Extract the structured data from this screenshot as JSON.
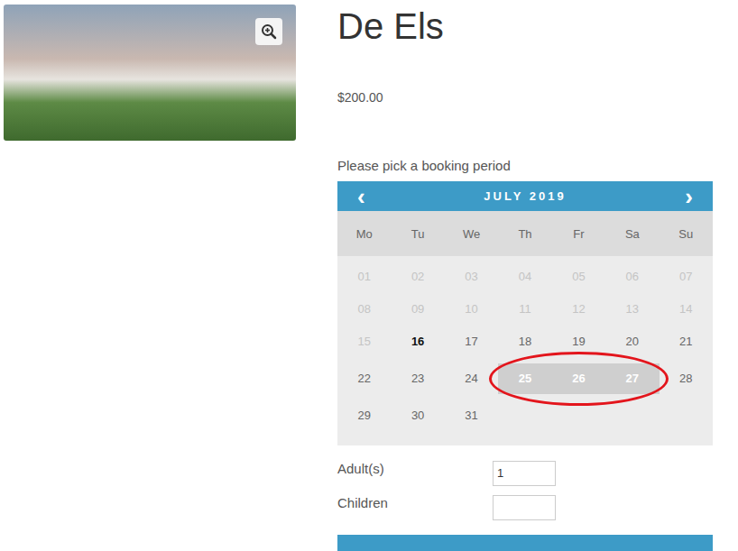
{
  "product": {
    "title": "De Els",
    "price": "$200.00"
  },
  "booking": {
    "prompt": "Please pick a booking period",
    "calendar": {
      "month": "JULY 2019",
      "prev": "‹",
      "next": "›",
      "weekdays": [
        "Mo",
        "Tu",
        "We",
        "Th",
        "Fr",
        "Sa",
        "Su"
      ],
      "weeks": [
        [
          {
            "label": "01",
            "disabled": true,
            "today": false,
            "selected": false,
            "circled": false
          },
          {
            "label": "02",
            "disabled": true,
            "today": false,
            "selected": false,
            "circled": false
          },
          {
            "label": "03",
            "disabled": true,
            "today": false,
            "selected": false,
            "circled": false
          },
          {
            "label": "04",
            "disabled": true,
            "today": false,
            "selected": false,
            "circled": false
          },
          {
            "label": "05",
            "disabled": true,
            "today": false,
            "selected": false,
            "circled": false
          },
          {
            "label": "06",
            "disabled": true,
            "today": false,
            "selected": false,
            "circled": false
          },
          {
            "label": "07",
            "disabled": true,
            "today": false,
            "selected": false,
            "circled": false
          }
        ],
        [
          {
            "label": "08",
            "disabled": true,
            "today": false,
            "selected": false,
            "circled": false
          },
          {
            "label": "09",
            "disabled": true,
            "today": false,
            "selected": false,
            "circled": false
          },
          {
            "label": "10",
            "disabled": true,
            "today": false,
            "selected": false,
            "circled": false
          },
          {
            "label": "11",
            "disabled": true,
            "today": false,
            "selected": false,
            "circled": false
          },
          {
            "label": "12",
            "disabled": true,
            "today": false,
            "selected": false,
            "circled": false
          },
          {
            "label": "13",
            "disabled": true,
            "today": false,
            "selected": false,
            "circled": false
          },
          {
            "label": "14",
            "disabled": true,
            "today": false,
            "selected": false,
            "circled": false
          }
        ],
        [
          {
            "label": "15",
            "disabled": true,
            "today": false,
            "selected": false,
            "circled": false
          },
          {
            "label": "16",
            "disabled": false,
            "today": true,
            "selected": false,
            "circled": false
          },
          {
            "label": "17",
            "disabled": false,
            "today": false,
            "selected": false,
            "circled": false
          },
          {
            "label": "18",
            "disabled": false,
            "today": false,
            "selected": false,
            "circled": false
          },
          {
            "label": "19",
            "disabled": false,
            "today": false,
            "selected": false,
            "circled": false
          },
          {
            "label": "20",
            "disabled": false,
            "today": false,
            "selected": false,
            "circled": false
          },
          {
            "label": "21",
            "disabled": false,
            "today": false,
            "selected": false,
            "circled": false
          }
        ],
        [
          {
            "label": "22",
            "disabled": false,
            "today": false,
            "selected": false,
            "circled": false
          },
          {
            "label": "23",
            "disabled": false,
            "today": false,
            "selected": false,
            "circled": false
          },
          {
            "label": "24",
            "disabled": false,
            "today": false,
            "selected": false,
            "circled": false
          },
          {
            "label": "25",
            "disabled": false,
            "today": false,
            "selected": true,
            "circled": true
          },
          {
            "label": "26",
            "disabled": false,
            "today": false,
            "selected": true,
            "circled": true
          },
          {
            "label": "27",
            "disabled": false,
            "today": false,
            "selected": true,
            "circled": true
          },
          {
            "label": "28",
            "disabled": false,
            "today": false,
            "selected": false,
            "circled": false
          }
        ],
        [
          {
            "label": "29",
            "disabled": false,
            "today": false,
            "selected": false,
            "circled": false
          },
          {
            "label": "30",
            "disabled": false,
            "today": false,
            "selected": false,
            "circled": false
          },
          {
            "label": "31",
            "disabled": false,
            "today": false,
            "selected": false,
            "circled": false
          }
        ]
      ]
    },
    "fields": [
      {
        "label": "Adult(s)",
        "value": "1"
      },
      {
        "label": "Children",
        "value": ""
      }
    ]
  }
}
